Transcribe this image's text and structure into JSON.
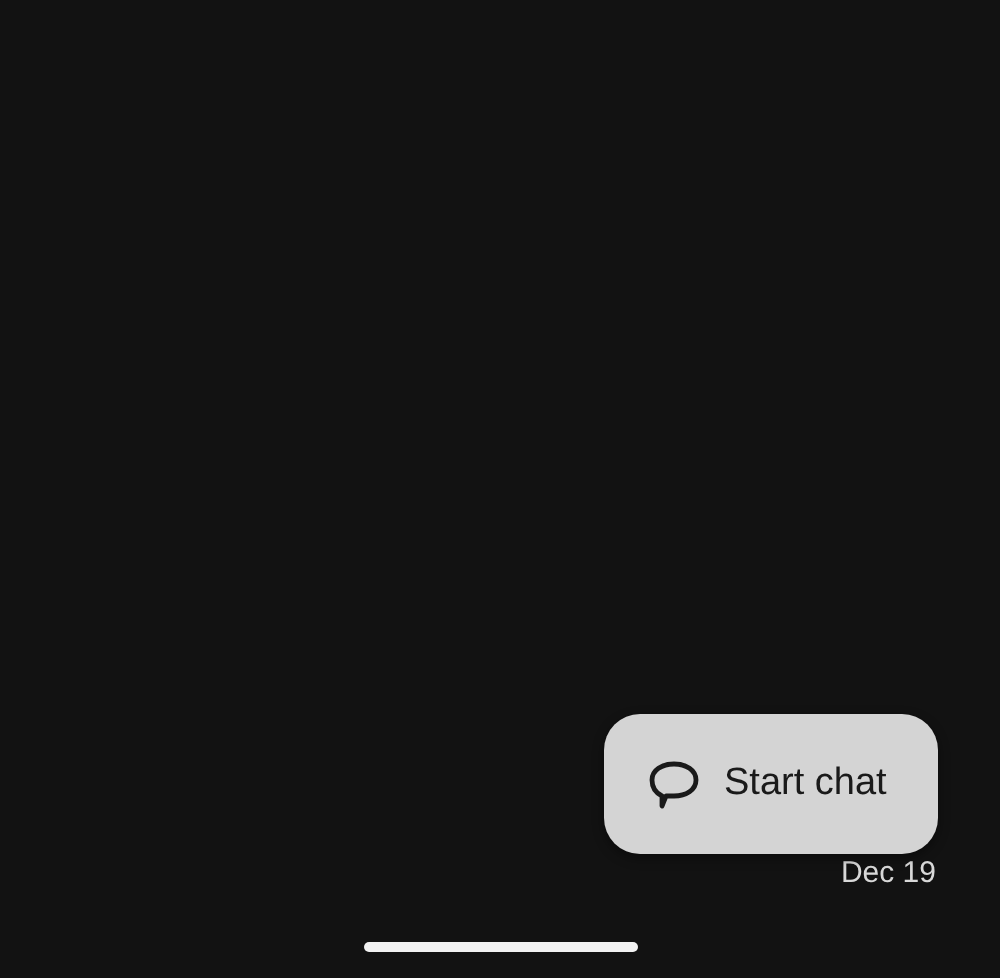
{
  "list": {
    "date": "Dec 19"
  },
  "fab": {
    "label": "Start chat"
  }
}
